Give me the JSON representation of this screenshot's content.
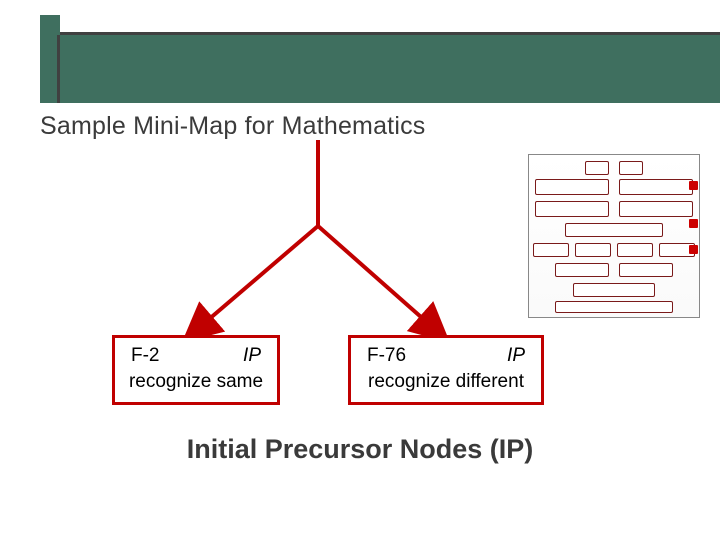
{
  "slide": {
    "title": "Sample Mini-Map for Mathematics",
    "footer": "Initial Precursor Nodes (IP)"
  },
  "nodes": {
    "left": {
      "code": "F-2",
      "tag": "IP",
      "desc": "recognize same"
    },
    "right": {
      "code": "F-76",
      "tag": "IP",
      "desc": "recognize different"
    }
  },
  "colors": {
    "accent_red": "#c00000",
    "header_green": "#3f6f5f",
    "header_dark": "#404040"
  }
}
